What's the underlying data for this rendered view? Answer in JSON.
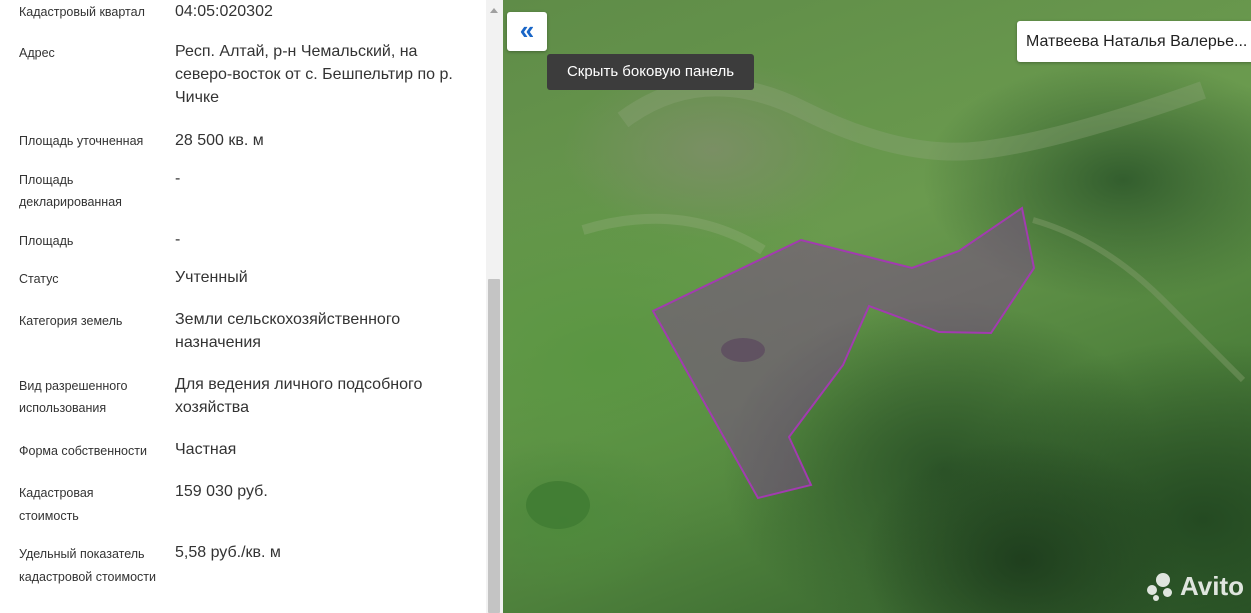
{
  "sidebar": {
    "rows": [
      {
        "label": "Кадастровый квартал",
        "value": "04:05:020302"
      },
      {
        "label": "Адрес",
        "value": "Респ. Алтай, р-н Чемальский, на северо-восток от с. Бешпельтир по р. Чичке"
      },
      {
        "label": "Площадь уточненная",
        "value": "28 500 кв. м"
      },
      {
        "label": "Площадь декларированная",
        "value": "-"
      },
      {
        "label": "Площадь",
        "value": "-"
      },
      {
        "label": "Статус",
        "value": "Учтенный"
      },
      {
        "label": "Категория земель",
        "value": "Земли сельскохозяйственного назначения"
      },
      {
        "label": "Вид разрешенного использования",
        "value": "Для ведения личного подсобного хозяйства"
      },
      {
        "label": "Форма собственности",
        "value": "Частная"
      },
      {
        "label": "Кадастровая стоимость",
        "value": "159 030 руб."
      },
      {
        "label": "Удельный показатель кадастровой стоимости",
        "value": "5,58 руб./кв. м"
      }
    ]
  },
  "map": {
    "collapse_icon": "double-chevron-left-icon",
    "collapse_glyph": "«",
    "tooltip": "Скрыть боковую панель",
    "owner_name": "Матвеева Наталья Валерье...",
    "parcel_color": "#a23bb0",
    "watermark": "Avito"
  }
}
